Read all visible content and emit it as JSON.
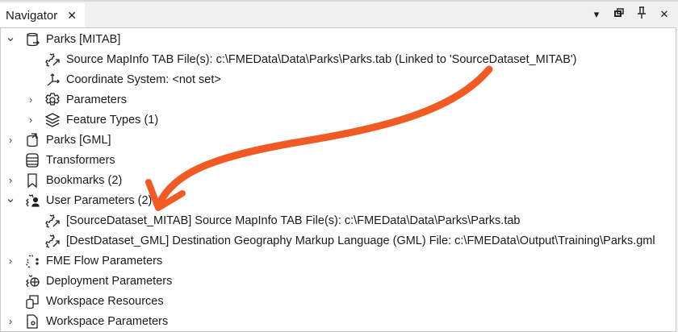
{
  "tab": {
    "title": "Navigator",
    "close": "✕"
  },
  "window_controls": {
    "menu": "▾",
    "float": "⧉",
    "pin": "pin",
    "close": "✕"
  },
  "tree": [
    {
      "label": "Parks [MITAB]",
      "level": 0,
      "expander": "expanded",
      "icon": "database-reader-icon"
    },
    {
      "label": "Source MapInfo TAB File(s): c:\\FMEData\\Data\\Parks\\Parks.tab (Linked to 'SourceDataset_MITAB')",
      "level": 1,
      "expander": "none",
      "icon": "linked-parameter-icon"
    },
    {
      "label": "Coordinate System: <not set>",
      "level": 1,
      "expander": "none",
      "icon": "coordinate-axes-icon"
    },
    {
      "label": "Parameters",
      "level": 1,
      "expander": "collapsed",
      "icon": "gear-icon"
    },
    {
      "label": "Feature Types (1)",
      "level": 1,
      "expander": "collapsed",
      "icon": "layers-icon"
    },
    {
      "label": "Parks [GML]",
      "level": 0,
      "expander": "collapsed",
      "icon": "database-writer-icon"
    },
    {
      "label": "Transformers",
      "level": 0,
      "expander": "none",
      "icon": "transformers-icon"
    },
    {
      "label": "Bookmarks (2)",
      "level": 0,
      "expander": "collapsed",
      "icon": "bookmark-icon"
    },
    {
      "label": "User Parameters (2)",
      "level": 0,
      "expander": "expanded",
      "icon": "user-parameters-icon"
    },
    {
      "label": "[SourceDataset_MITAB] Source MapInfo TAB File(s): c:\\FMEData\\Data\\Parks\\Parks.tab",
      "level": 1,
      "expander": "none",
      "icon": "linked-parameter-icon"
    },
    {
      "label": "[DestDataset_GML] Destination Geography Markup Language (GML) File: c:\\FMEData\\Output\\Training\\Parks.gml",
      "level": 1,
      "expander": "none",
      "icon": "linked-parameter-icon"
    },
    {
      "label": "FME Flow Parameters",
      "level": 0,
      "expander": "collapsed",
      "icon": "flow-parameters-icon"
    },
    {
      "label": "Deployment Parameters",
      "level": 0,
      "expander": "none",
      "icon": "globe-gear-icon"
    },
    {
      "label": "Workspace Resources",
      "level": 0,
      "expander": "none",
      "icon": "resources-icon"
    },
    {
      "label": "Workspace Parameters",
      "level": 0,
      "expander": "collapsed",
      "icon": "workspace-gear-icon"
    }
  ],
  "annotation": {
    "color": "#f15a22",
    "from_row": "Source MapInfo TAB File(s)",
    "to_row": "User Parameters (2)"
  }
}
